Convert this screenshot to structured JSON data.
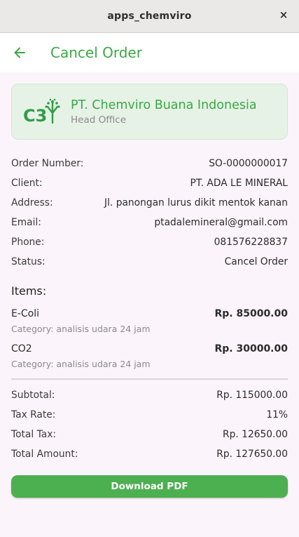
{
  "window": {
    "title": "apps_chemviro",
    "close_glyph": "×"
  },
  "appbar": {
    "title": "Cancel Order",
    "back_icon": "arrow-left-icon"
  },
  "company": {
    "logo_text": "C3",
    "name": "PT. Chemviro Buana Indonesia",
    "subtitle": "Head Office"
  },
  "order": {
    "number": {
      "label": "Order Number:",
      "value": "SO-0000000017"
    },
    "client": {
      "label": "Client:",
      "value": "PT. ADA LE MINERAL"
    },
    "address": {
      "label": "Address:",
      "value": "Jl. panongan lurus dikit mentok kanan"
    },
    "email": {
      "label": "Email:",
      "value": "ptadalemineral@gmail.com"
    },
    "phone": {
      "label": "Phone:",
      "value": "081576228837"
    },
    "status": {
      "label": "Status:",
      "value": "Cancel Order"
    }
  },
  "items": {
    "heading": "Items:",
    "list": [
      {
        "name": "E-Coli",
        "price": "Rp. 85000.00",
        "category": "Category: analisis udara 24 jam"
      },
      {
        "name": "CO2",
        "price": "Rp. 30000.00",
        "category": "Category: analisis udara 24 jam"
      }
    ]
  },
  "totals": {
    "subtotal": {
      "label": "Subtotal:",
      "value": "Rp. 115000.00"
    },
    "tax_rate": {
      "label": "Tax Rate:",
      "value": "11%"
    },
    "total_tax": {
      "label": "Total Tax:",
      "value": "Rp. 12650.00"
    },
    "total_amount": {
      "label": "Total Amount:",
      "value": "Rp. 127650.00"
    }
  },
  "actions": {
    "download_label": "Download PDF"
  },
  "colors": {
    "accent": "#3aa845",
    "button": "#4caf50",
    "card_bg": "#e6f2e6",
    "page_bg": "#fbf5fb"
  }
}
